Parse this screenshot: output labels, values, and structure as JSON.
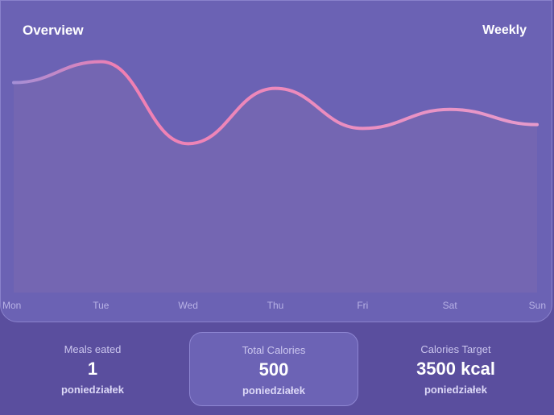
{
  "overview": {
    "title": "Overview",
    "period": "Weekly"
  },
  "chart_data": {
    "type": "area",
    "categories": [
      "Mon",
      "Tue",
      "Wed",
      "Thu",
      "Fri",
      "Sat",
      "Sun"
    ],
    "series": [
      {
        "values": [
          3.0,
          3.55,
          1.4,
          2.85,
          1.8,
          2.3,
          1.9
        ]
      }
    ],
    "ylim": [
      -2.5,
      4.3
    ],
    "grid": false,
    "colors": {
      "line_start": "#a48fd6",
      "line_peak": "#f07fb2",
      "line_end": "#e69acb",
      "fill": "#7466b2"
    }
  },
  "stats": [
    {
      "label": "Meals eated",
      "value": "1",
      "sub": "poniedziałek"
    },
    {
      "label": "Total Calories",
      "value": "500",
      "sub": "poniedziałek"
    },
    {
      "label": "Calories Target",
      "value": "3500 kcal",
      "sub": "poniedziałek"
    }
  ]
}
